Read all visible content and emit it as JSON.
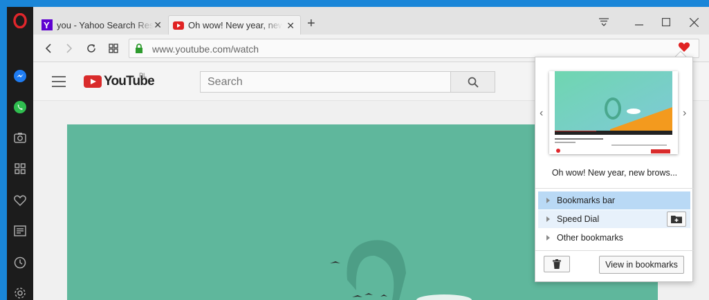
{
  "tabs": [
    {
      "title": "you - Yahoo Search Results",
      "favicon": "yahoo-icon",
      "active": false
    },
    {
      "title": "Oh wow! New year, new browser",
      "favicon": "youtube-icon",
      "active": true
    }
  ],
  "address": {
    "url": "www.youtube.com/watch"
  },
  "youtube": {
    "logo_text": "YouTube",
    "region": "PL",
    "search_placeholder": "Search"
  },
  "popup": {
    "page_title": "Oh wow! New year, new brows...",
    "folders": [
      {
        "label": "Bookmarks bar",
        "state": "selected"
      },
      {
        "label": "Speed Dial",
        "state": "hover"
      },
      {
        "label": "Other bookmarks",
        "state": "normal"
      }
    ],
    "view_button": "View in bookmarks"
  },
  "colors": {
    "accent": "#1a86d8",
    "heart": "#e02222",
    "selected": "#b9d9f5",
    "video_bg": "#5fb79c"
  }
}
